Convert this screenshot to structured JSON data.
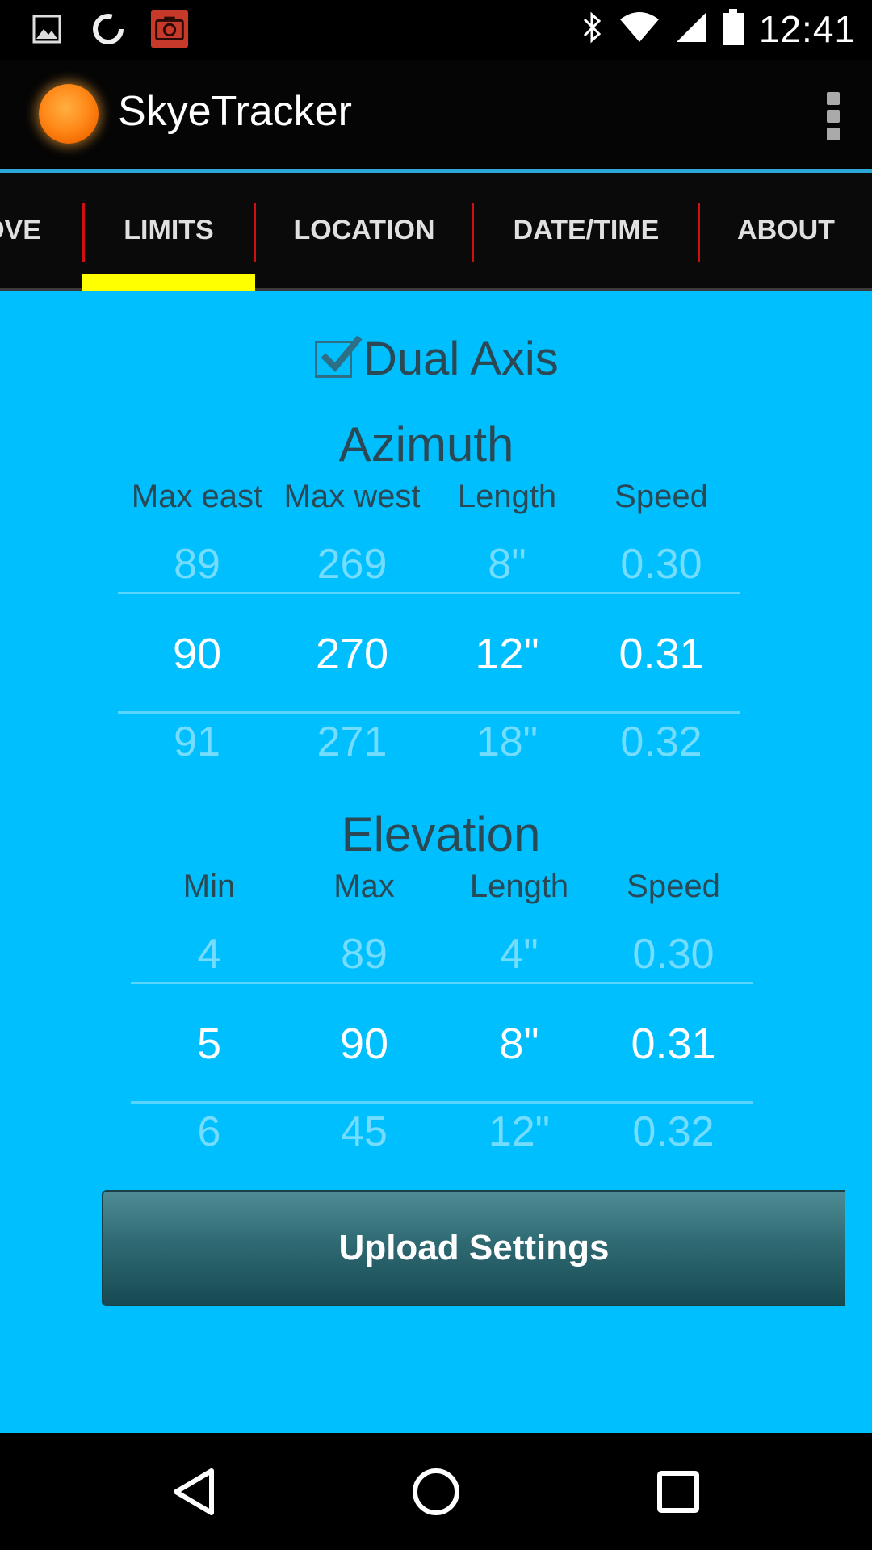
{
  "status_bar": {
    "notification_icons": [
      "image-icon",
      "sync-icon",
      "camera-icon"
    ],
    "system_icons": [
      "bluetooth-icon",
      "wifi-icon",
      "signal-icon",
      "battery-icon"
    ],
    "time": "12:41"
  },
  "app_bar": {
    "title": "SkyeTracker",
    "logo": "sun-logo",
    "menu_icon": "overflow-menu-icon"
  },
  "tabs": [
    {
      "label": "OVE",
      "selected": false
    },
    {
      "label": "LIMITS",
      "selected": true
    },
    {
      "label": "LOCATION",
      "selected": false
    },
    {
      "label": "DATE/TIME",
      "selected": false
    },
    {
      "label": "ABOUT",
      "selected": false
    }
  ],
  "colors": {
    "content_bg": "#00bfff",
    "tab_indicator": "#ffff00",
    "tab_separator": "#d01010",
    "button": "#2f6a73"
  },
  "dual_axis": {
    "label": "Dual Axis",
    "checked": true
  },
  "azimuth": {
    "title": "Azimuth",
    "columns": [
      {
        "header": "Max east",
        "prev": "89",
        "value": "90",
        "next": "91"
      },
      {
        "header": "Max west",
        "prev": "269",
        "value": "270",
        "next": "271"
      },
      {
        "header": "Length",
        "prev": "8\"",
        "value": "12\"",
        "next": "18\""
      },
      {
        "header": "Speed",
        "prev": "0.30",
        "value": "0.31",
        "next": "0.32"
      }
    ]
  },
  "elevation": {
    "title": "Elevation",
    "columns": [
      {
        "header": "Min",
        "prev": "4",
        "value": "5",
        "next": "6"
      },
      {
        "header": "Max",
        "prev": "89",
        "value": "90",
        "next": "45"
      },
      {
        "header": "Length",
        "prev": "4\"",
        "value": "8\"",
        "next": "12\""
      },
      {
        "header": "Speed",
        "prev": "0.30",
        "value": "0.31",
        "next": "0.32"
      }
    ]
  },
  "upload_button": {
    "label": "Upload Settings"
  },
  "nav_bar": {
    "buttons": [
      "back-icon",
      "home-icon",
      "recents-icon"
    ]
  }
}
